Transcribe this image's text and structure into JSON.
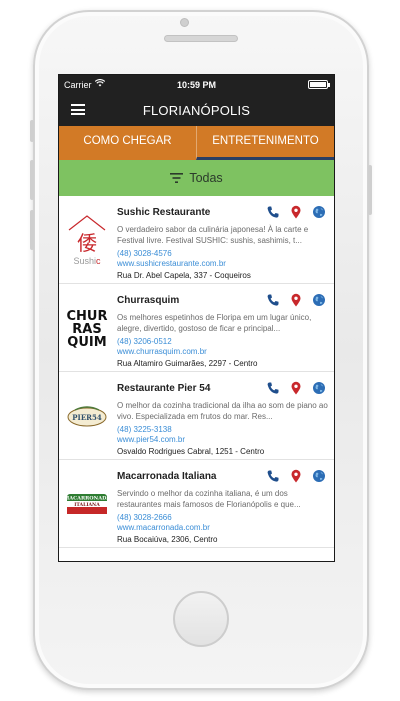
{
  "status_bar": {
    "carrier": "Carrier",
    "time": "10:59 PM"
  },
  "nav": {
    "title": "FLORIANÓPOLIS"
  },
  "tabs": [
    {
      "label": "COMO CHEGAR",
      "active": false
    },
    {
      "label": "ENTRETENIMENTO",
      "active": true
    }
  ],
  "filter": {
    "label": "Todas",
    "icon": "filter-icon"
  },
  "colors": {
    "topbar": "#212121",
    "tabs": "#d27a26",
    "tab_indicator": "#2a3e63",
    "filter_bar": "#7ec261",
    "link": "#3a8dd6",
    "phone_icon": "#1f4e8c",
    "map_pin_icon": "#c8282c",
    "globe_icon": "#2c6db5"
  },
  "items": [
    {
      "name": "Sushic Restaurante",
      "description": "O verdadeiro sabor da culinária japonesa! À la carte e Festival livre. Festival SUSHIC: sushis, sashimis, t...",
      "phone": "(48) 3028-4576",
      "url": "www.sushicrestaurante.com.br",
      "address": "Rua Dr. Abel Capela, 337 - Coqueiros",
      "logo_text": "Sushic"
    },
    {
      "name": "Churrasquim",
      "description": "Os melhores espetinhos de Floripa em um lugar único, alegre, divertido, gostoso de ficar e principal...",
      "phone": "(48) 3206-0512",
      "url": "www.churrasquim.com.br",
      "address": "Rua Altamiro Guimarães, 2297 - Centro",
      "logo_text": "CHURRASQUIM"
    },
    {
      "name": "Restaurante Pier 54",
      "description": "O melhor da cozinha tradicional da ilha ao som de piano ao vivo. Especializada em frutos do mar. Res...",
      "phone": "(48) 3225-3138",
      "url": "www.pier54.com.br",
      "address": "Osvaldo Rodrigues Cabral, 1251 - Centro",
      "logo_text": "PIER 54"
    },
    {
      "name": "Macarronada Italiana",
      "description": "Servindo o melhor da cozinha italiana, é um dos restaurantes mais famosos de Florianópolis e que...",
      "phone": "(48) 3028-2666",
      "url": "www.macarronada.com.br",
      "address": "Rua Bocaiúva, 2306, Centro",
      "logo_text": "MACARRONADA ITALIANA"
    }
  ]
}
